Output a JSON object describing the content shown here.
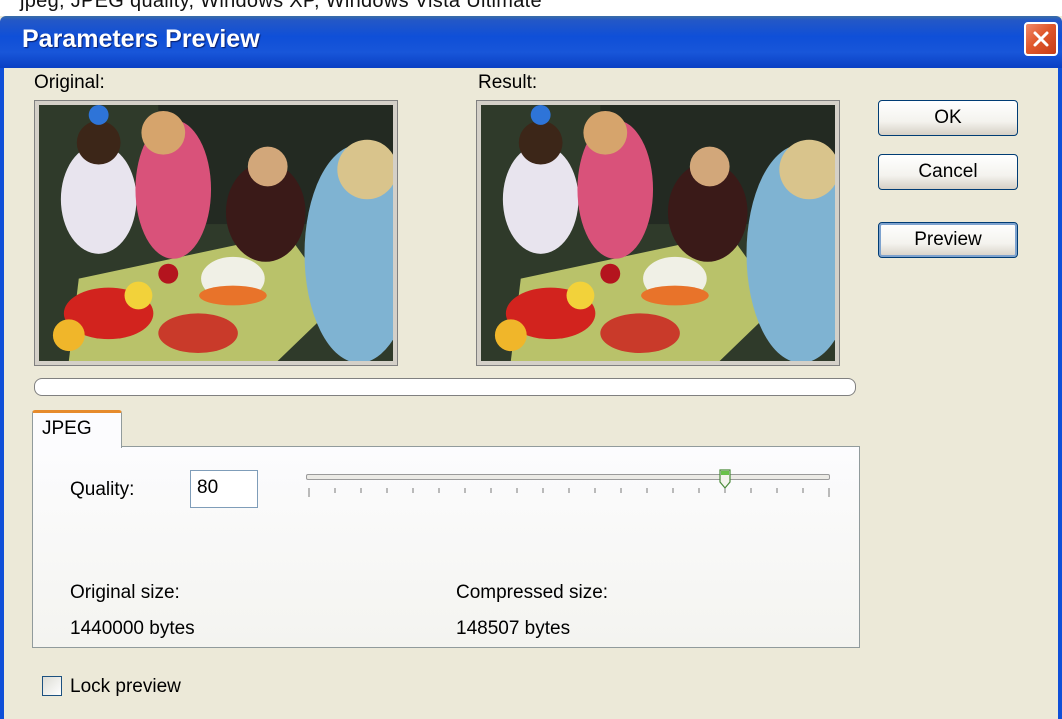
{
  "window": {
    "partial_text": "jpeg, JPEG quality, Windows XP, Windows Vista Ultimate",
    "title": "Parameters Preview"
  },
  "preview": {
    "original_label": "Original:",
    "result_label": "Result:"
  },
  "buttons": {
    "ok": "OK",
    "cancel": "Cancel",
    "preview": "Preview"
  },
  "progress": {
    "value": 0
  },
  "tabs": [
    {
      "label": "JPEG",
      "selected": true
    }
  ],
  "jpeg": {
    "quality_label": "Quality:",
    "quality_value": "80",
    "slider": {
      "min": 0,
      "max": 100,
      "value": 80,
      "tick_count": 21
    },
    "original_size_label": "Original size:",
    "original_size_value": "1440000 bytes",
    "compressed_size_label": "Compressed size:",
    "compressed_size_value": "148507 bytes"
  },
  "lock_preview": {
    "label": "Lock preview",
    "checked": false
  },
  "colors": {
    "titlebar": "#0f4fd8",
    "dialog_bg": "#ece9d8",
    "tab_accent": "#e68b2c",
    "close_button": "#e0582c"
  },
  "icons": {
    "close": "close-icon"
  }
}
